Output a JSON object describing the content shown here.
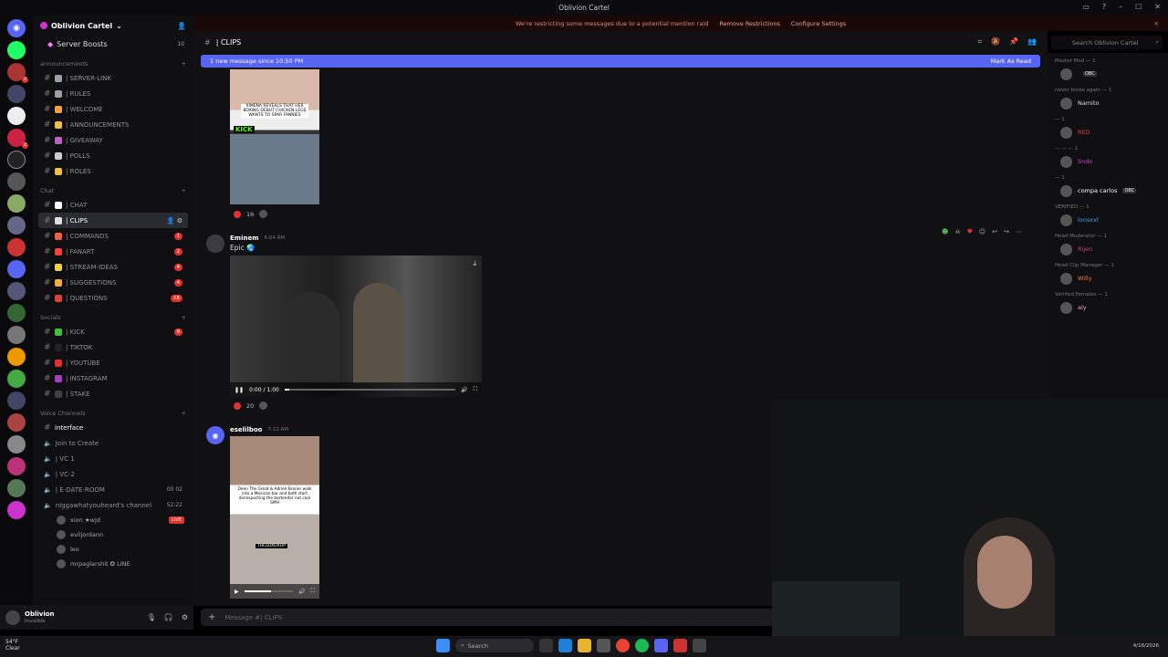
{
  "window": {
    "title": "Oblivion Cartel"
  },
  "banner": {
    "text": "We're restricting some messages due to a potential mention raid",
    "remove": "Remove Restrictions",
    "configure": "Configure Settings"
  },
  "server": {
    "name": "Oblivion Cartel",
    "boosts_label": "Server Boosts",
    "boosts_count": "10"
  },
  "categories": [
    {
      "name": "announcements",
      "channels": [
        {
          "label": "| SERVER-LINK",
          "emoji_color": "#9aa0a6",
          "badge": ""
        },
        {
          "label": "| RULES",
          "emoji_color": "#9aa0a6",
          "badge": ""
        },
        {
          "label": "| WELCOME",
          "emoji_color": "#f0a040",
          "badge": ""
        },
        {
          "label": "| ANNOUNCEMENTS",
          "emoji_color": "#f0c040",
          "badge": ""
        },
        {
          "label": "| GIVEAWAY",
          "emoji_color": "#c060c0",
          "badge": ""
        },
        {
          "label": "| POLLS",
          "emoji_color": "#cccccc",
          "badge": ""
        },
        {
          "label": "| ROLES",
          "emoji_color": "#f0c040",
          "badge": ""
        }
      ]
    },
    {
      "name": "Chat",
      "channels": [
        {
          "label": "| CHAT",
          "emoji_color": "#ffffff",
          "badge": ""
        },
        {
          "label": "| CLIPS",
          "emoji_color": "#dddddd",
          "badge": "",
          "active": true
        },
        {
          "label": "| COMMANDS",
          "emoji_color": "#f06040",
          "badge": "1"
        },
        {
          "label": "| FANART",
          "emoji_color": "#f04040",
          "badge": "2"
        },
        {
          "label": "| STREAM-IDEAS",
          "emoji_color": "#f0d040",
          "badge": "4"
        },
        {
          "label": "| SUGGESTIONS",
          "emoji_color": "#f0b040",
          "badge": "4"
        },
        {
          "label": "| QUESTIONS",
          "emoji_color": "#e04040",
          "badge": "16"
        }
      ]
    },
    {
      "name": "Socials",
      "channels": [
        {
          "label": "| KICK",
          "emoji_color": "#40c040",
          "badge": "9"
        },
        {
          "label": "| TIKTOK",
          "emoji_color": "#222222",
          "badge": ""
        },
        {
          "label": "| YOUTUBE",
          "emoji_color": "#e03030",
          "badge": ""
        },
        {
          "label": "| INSTAGRAM",
          "emoji_color": "#a040c0",
          "badge": ""
        },
        {
          "label": "| STAKE",
          "emoji_color": "#404040",
          "badge": ""
        }
      ]
    }
  ],
  "voice": {
    "category": "Voice Channels",
    "interface": "interface",
    "channels": [
      {
        "label": "Join to Create",
        "right": ""
      },
      {
        "label": "| VC 1",
        "right": ""
      },
      {
        "label": "| VC-2",
        "right": ""
      },
      {
        "label": "| E-DATE-ROOM",
        "right": "00 02"
      },
      {
        "label": "niggawhatyouheard's channel",
        "right": "52:22"
      }
    ],
    "live_label": "LIVE",
    "users": [
      "xion ★wjd",
      "eviljordann",
      "leo",
      "mrpaglarshit ✪ LINE"
    ]
  },
  "user": {
    "name": "Oblivion",
    "status": "Invisible"
  },
  "channel": {
    "name": "| CLIPS"
  },
  "search": {
    "placeholder": "Search Oblivion Cartel"
  },
  "new_messages": {
    "text": "1 new message since 10:50 PM",
    "mark": "Mark As Read"
  },
  "messages": {
    "first_reaction": "16",
    "m1": {
      "author": "Eminem",
      "time": "6:04 AM",
      "text": "Epic 🌏",
      "video_time": "0:00 / 1:00",
      "reaction": "20"
    },
    "m2": {
      "author": "eselilboo",
      "time": "7:22 AM"
    },
    "img1_caption": "XIMENA REVEALS THAT HER BOXING DEBUT CHICKEN LEGS WANTS TO SPAR FANNIES",
    "img2_caption": "Deen The Great & Adrien Broner walk into a Mexican bar and both start disrespecting the bartender not cool SMH",
    "img2_tag": "THESOXDROP",
    "kick_tag": "KICK"
  },
  "composer": {
    "placeholder": "Message #| CLIPS"
  },
  "members": {
    "roles": [
      {
        "title": "Master Mod — 1",
        "members": [
          {
            "name": "",
            "color": "#b040d0",
            "tag": "OBC"
          }
        ]
      },
      {
        "title": "never broke again — 1",
        "members": [
          {
            "name": "Namito",
            "color": "#dddddd",
            "tag": ""
          }
        ]
      },
      {
        "title": "— 1",
        "members": [
          {
            "name": "RED",
            "color": "#e04040",
            "tag": ""
          }
        ]
      },
      {
        "title": "— — — 1",
        "members": [
          {
            "name": "Sndx",
            "color": "#d040d0",
            "tag": ""
          }
        ]
      },
      {
        "title": "— 1",
        "members": [
          {
            "name": "compa carlos",
            "color": "#ffffff",
            "tag": "OBC"
          }
        ]
      },
      {
        "title": "VERIFIED — 1",
        "members": [
          {
            "name": "lonsxxl",
            "color": "#40a0f0",
            "tag": ""
          }
        ]
      },
      {
        "title": "Head Moderator — 1",
        "members": [
          {
            "name": "Rijen",
            "color": "#c04080",
            "tag": ""
          }
        ]
      },
      {
        "title": "Head Clip Manager — 1",
        "members": [
          {
            "name": "Willy",
            "color": "#f08040",
            "tag": ""
          }
        ]
      },
      {
        "title": "Verified Females — 1",
        "members": [
          {
            "name": "aly",
            "color": "#f0a0c0",
            "tag": ""
          }
        ]
      }
    ]
  },
  "taskbar": {
    "weather_temp": "54°F",
    "weather_desc": "Clear",
    "search_label": "Search",
    "date": "4/16/2026"
  },
  "icons": [
    "discord-icon",
    "hash-icon",
    "speaker-icon",
    "search-icon",
    "pin-icon",
    "members-icon",
    "mic-icon",
    "headphones-icon",
    "gear-icon",
    "play-icon",
    "pause-icon",
    "fullscreen-icon",
    "volume-icon",
    "windows-icon"
  ]
}
